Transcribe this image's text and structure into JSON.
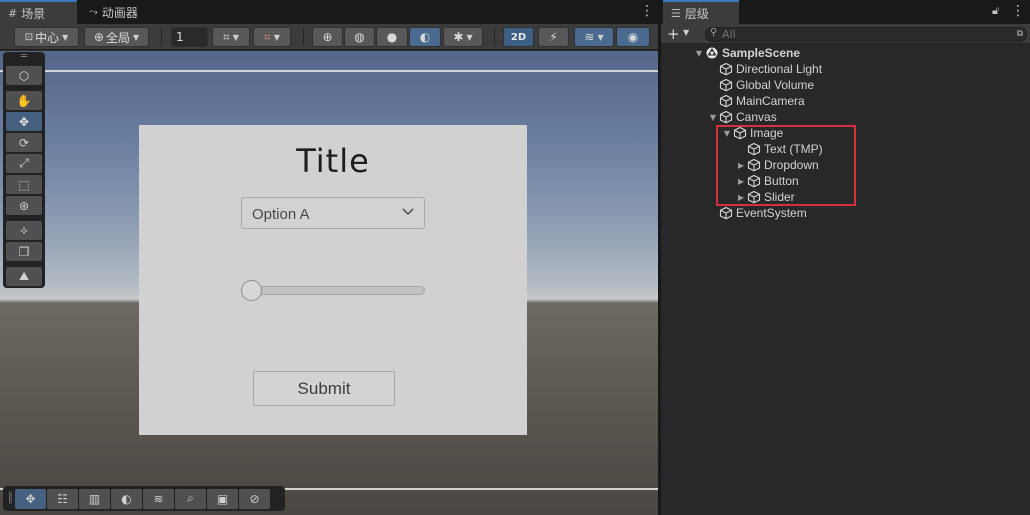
{
  "scene_tab": {
    "icon": "grid-icon",
    "label": "场景"
  },
  "animator_tab": {
    "icon": "animator-icon",
    "label": "动画器"
  },
  "toolbar": {
    "pivot_label": "中心",
    "space_label": "全局",
    "increment_value": "1",
    "mode_2d_label": "2D"
  },
  "hierarchy": {
    "tab_label": "层级",
    "search_placeholder": "All",
    "scene_name": "SampleScene",
    "items": [
      {
        "label": "Directional Light",
        "depth": 1,
        "expandable": false,
        "expanded": false
      },
      {
        "label": "Global Volume",
        "depth": 1,
        "expandable": false,
        "expanded": false
      },
      {
        "label": "MainCamera",
        "depth": 1,
        "expandable": false,
        "expanded": false
      },
      {
        "label": "Canvas",
        "depth": 1,
        "expandable": true,
        "expanded": true
      },
      {
        "label": "Image",
        "depth": 2,
        "expandable": true,
        "expanded": true
      },
      {
        "label": "Text (TMP)",
        "depth": 3,
        "expandable": false,
        "expanded": false
      },
      {
        "label": "Dropdown",
        "depth": 3,
        "expandable": true,
        "expanded": false
      },
      {
        "label": "Button",
        "depth": 3,
        "expandable": true,
        "expanded": false
      },
      {
        "label": "Slider",
        "depth": 3,
        "expandable": true,
        "expanded": false
      },
      {
        "label": "EventSystem",
        "depth": 1,
        "expandable": false,
        "expanded": false
      }
    ]
  },
  "ui_preview": {
    "title": "Title",
    "dropdown_value": "Option A",
    "slider_value": 0,
    "button_label": "Submit"
  },
  "colors": {
    "accent": "#3a79bb",
    "highlight_box": "#d6303f",
    "panel_bg": "#282828",
    "toolbar_bg": "#3c3c3c"
  }
}
